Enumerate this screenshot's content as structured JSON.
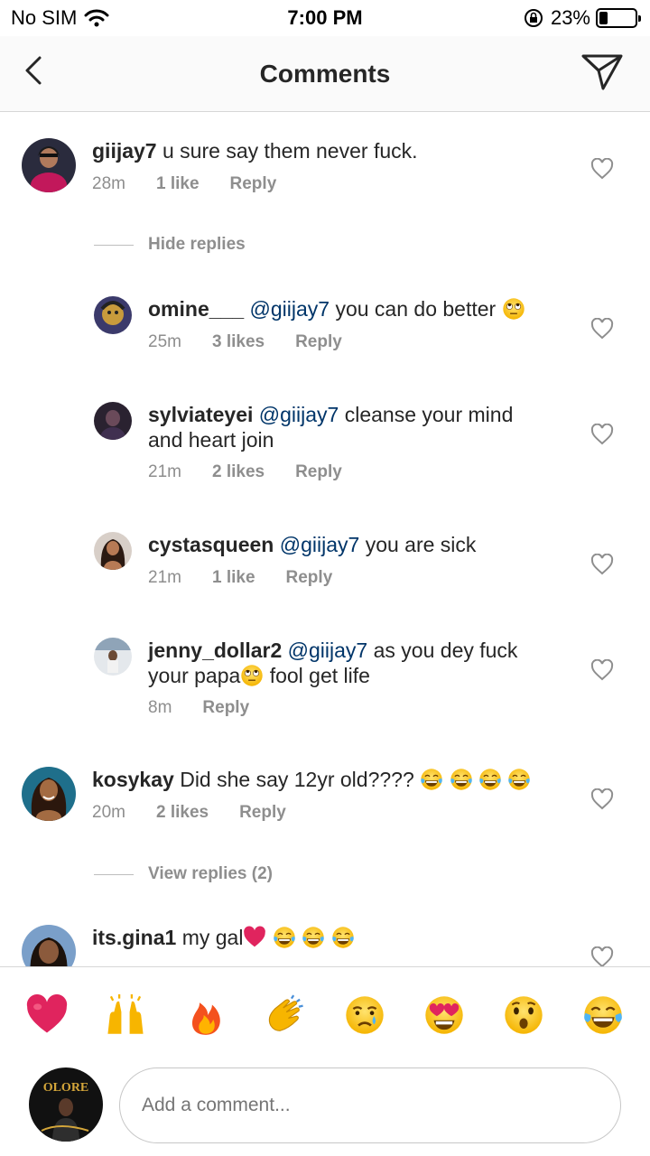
{
  "status_bar": {
    "carrier": "No SIM",
    "time": "7:00 PM",
    "battery_percent": "23%",
    "battery_level": 0.23
  },
  "header": {
    "title": "Comments",
    "back_icon": "chevron-left-icon",
    "send_icon": "paper-plane-icon"
  },
  "comments": [
    {
      "username": "giijay7",
      "text": "u sure say them never fuck.",
      "time": "28m",
      "likes": "1 like",
      "reply": "Reply"
    },
    {
      "toggle": "Hide replies"
    },
    {
      "username": "omine___",
      "mention": "@giijay7",
      "text": "you can do better",
      "time": "25m",
      "likes": "3 likes",
      "reply": "Reply"
    },
    {
      "username": "sylviateyei",
      "mention": "@giijay7",
      "text": "cleanse your mind",
      "text2": "and heart join",
      "time": "21m",
      "likes": "2 likes",
      "reply": "Reply"
    },
    {
      "username": "cystasqueen",
      "mention": "@giijay7",
      "text": "you are sick",
      "time": "21m",
      "likes": "1 like",
      "reply": "Reply"
    },
    {
      "username": "jenny_dollar2",
      "mention": "@giijay7",
      "text": "as you dey fuck",
      "text2a": "your papa",
      "text2b": "fool get life",
      "time": "8m",
      "reply": "Reply"
    },
    {
      "username": "kosykay",
      "text": "Did she say 12yr old????",
      "time": "20m",
      "likes": "2 likes",
      "reply": "Reply"
    },
    {
      "toggle": "View replies (2)"
    },
    {
      "username": "its.gina1",
      "text": "my gal"
    }
  ],
  "emoji_bar": [
    "red-heart",
    "raising-hands",
    "fire",
    "clapping-hands",
    "crying-face",
    "heart-eyes",
    "astonished-face",
    "tears-of-joy"
  ],
  "composer": {
    "placeholder": "Add a comment...",
    "avatar_text": "OLORE"
  }
}
